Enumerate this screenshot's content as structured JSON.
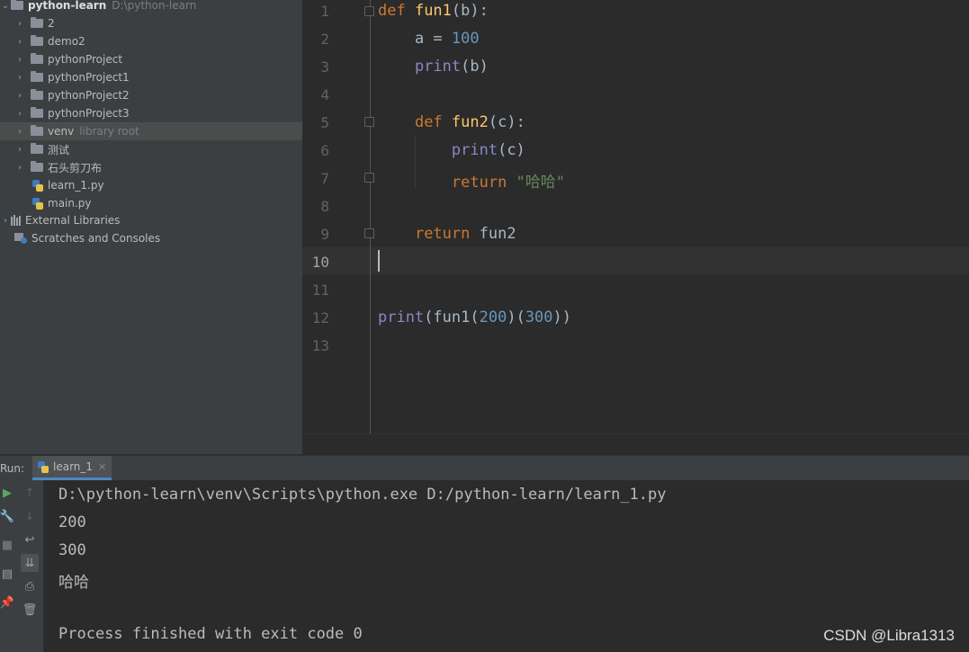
{
  "project_tree": {
    "root": {
      "name": "python-learn",
      "path": "D:\\python-learn"
    },
    "items": [
      {
        "label": "2",
        "type": "folder"
      },
      {
        "label": "demo2",
        "type": "folder"
      },
      {
        "label": "pythonProject",
        "type": "folder"
      },
      {
        "label": "pythonProject1",
        "type": "folder"
      },
      {
        "label": "pythonProject2",
        "type": "folder"
      },
      {
        "label": "pythonProject3",
        "type": "folder"
      },
      {
        "label": "venv",
        "hint": "library root",
        "type": "folder",
        "selected": true
      },
      {
        "label": "测试",
        "type": "folder"
      },
      {
        "label": "石头剪刀布",
        "type": "folder"
      },
      {
        "label": "learn_1.py",
        "type": "python-file"
      },
      {
        "label": "main.py",
        "type": "python-file"
      }
    ],
    "external_libraries": "External Libraries",
    "scratches": "Scratches and Consoles"
  },
  "editor": {
    "current_line": 10,
    "lines": [
      {
        "num": "1",
        "tokens": [
          {
            "t": "def ",
            "c": "kw"
          },
          {
            "t": "fun1",
            "c": "fn"
          },
          {
            "t": "(b):",
            "c": "var"
          }
        ]
      },
      {
        "num": "2",
        "tokens": [
          {
            "t": "    a = ",
            "c": "var"
          },
          {
            "t": "100",
            "c": "num"
          }
        ]
      },
      {
        "num": "3",
        "tokens": [
          {
            "t": "    ",
            "c": "var"
          },
          {
            "t": "print",
            "c": "bi"
          },
          {
            "t": "(b)",
            "c": "var"
          }
        ]
      },
      {
        "num": "4",
        "tokens": []
      },
      {
        "num": "5",
        "tokens": [
          {
            "t": "    ",
            "c": "var"
          },
          {
            "t": "def ",
            "c": "kw"
          },
          {
            "t": "fun2",
            "c": "fn"
          },
          {
            "t": "(c):",
            "c": "var"
          }
        ]
      },
      {
        "num": "6",
        "tokens": [
          {
            "t": "        ",
            "c": "var"
          },
          {
            "t": "print",
            "c": "bi"
          },
          {
            "t": "(c)",
            "c": "var"
          }
        ]
      },
      {
        "num": "7",
        "tokens": [
          {
            "t": "        ",
            "c": "var"
          },
          {
            "t": "return ",
            "c": "kw"
          },
          {
            "t": "\"哈哈\"",
            "c": "str"
          }
        ]
      },
      {
        "num": "8",
        "tokens": []
      },
      {
        "num": "9",
        "tokens": [
          {
            "t": "    ",
            "c": "var"
          },
          {
            "t": "return ",
            "c": "kw"
          },
          {
            "t": "fun2",
            "c": "var"
          }
        ]
      },
      {
        "num": "10",
        "tokens": []
      },
      {
        "num": "11",
        "tokens": []
      },
      {
        "num": "12",
        "tokens": [
          {
            "t": "print",
            "c": "bi"
          },
          {
            "t": "(fun1(",
            "c": "var"
          },
          {
            "t": "200",
            "c": "num"
          },
          {
            "t": ")(",
            "c": "var"
          },
          {
            "t": "300",
            "c": "num"
          },
          {
            "t": "))",
            "c": "var"
          }
        ]
      },
      {
        "num": "13",
        "tokens": []
      }
    ]
  },
  "run_panel": {
    "label": "Run:",
    "tab": "learn_1",
    "output": [
      "D:\\python-learn\\venv\\Scripts\\python.exe D:/python-learn/learn_1.py",
      "200",
      "300",
      "哈哈",
      "",
      "Process finished with exit code 0"
    ]
  },
  "watermark": "CSDN @Libra1313",
  "colors": {
    "keyword": "#cc7832",
    "function": "#ffc66d",
    "builtin": "#8888c6",
    "number": "#6897bb",
    "string": "#6a8759"
  }
}
